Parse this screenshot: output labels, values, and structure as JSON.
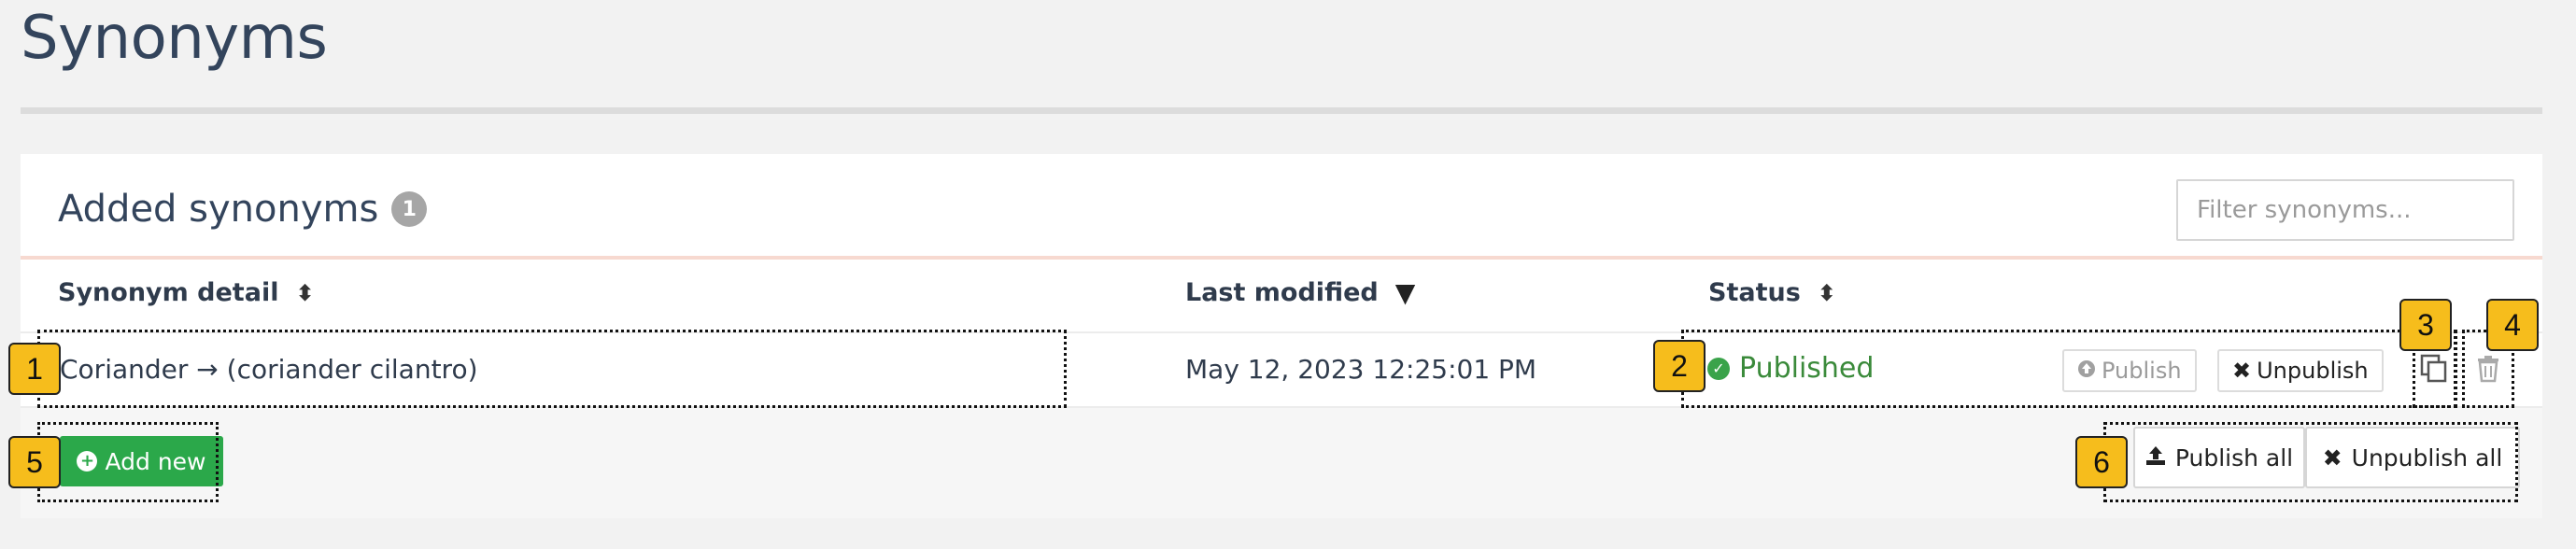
{
  "page": {
    "title": "Synonyms"
  },
  "panel": {
    "title": "Added synonyms",
    "count": "1",
    "filter_placeholder": "Filter synonyms..."
  },
  "table": {
    "columns": [
      {
        "label": "Synonym detail",
        "sort_icon": "sort-icon"
      },
      {
        "label": "Last modified",
        "sort_icon": "sort-down-icon"
      },
      {
        "label": "Status",
        "sort_icon": "sort-icon"
      }
    ],
    "rows": [
      {
        "detail": "Coriander → (coriander cilantro)",
        "last_modified": "May 12, 2023 12:25:01 PM",
        "status": "Published",
        "publish_label": "Publish",
        "unpublish_label": "Unpublish"
      }
    ]
  },
  "footer": {
    "add_label": "Add new",
    "publish_all_label": "Publish all",
    "unpublish_all_label": "Unpublish all"
  },
  "markers": [
    "1",
    "2",
    "3",
    "4",
    "5",
    "6"
  ],
  "colors": {
    "accent_green": "#2ba84a",
    "status_green": "#3a8a3a",
    "marker_yellow": "#f6bd1c"
  }
}
